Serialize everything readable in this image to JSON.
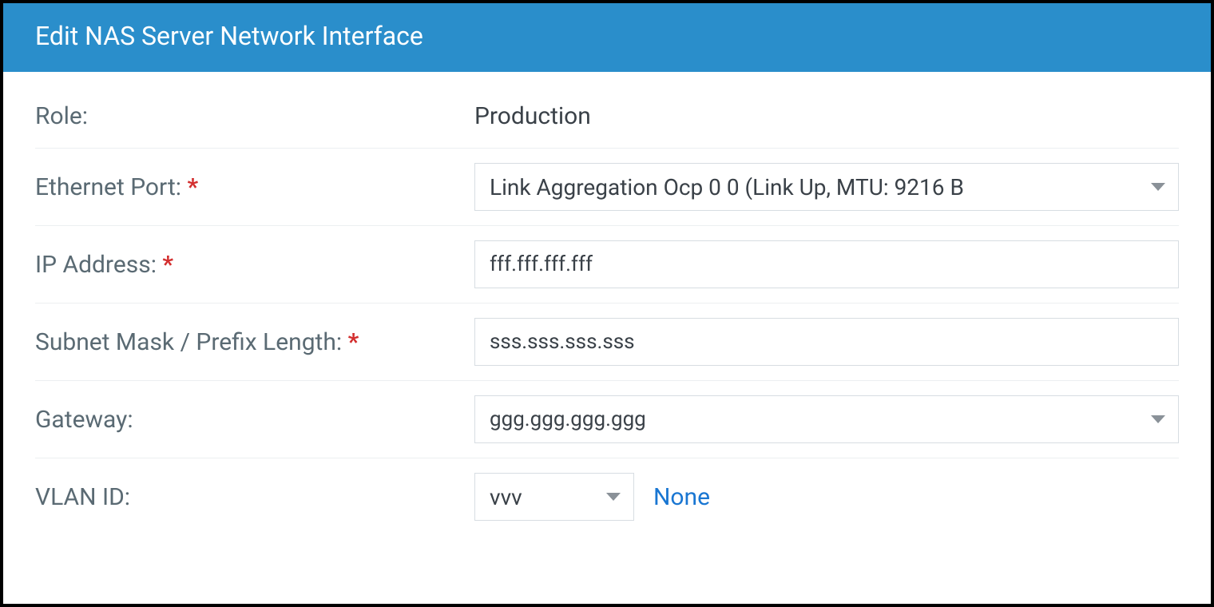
{
  "dialog": {
    "title": "Edit NAS Server Network Interface"
  },
  "fields": {
    "role": {
      "label": "Role:",
      "value": "Production"
    },
    "ethernet_port": {
      "label": "Ethernet Port: ",
      "required_marker": "*",
      "selected": "Link Aggregation Ocp 0 0 (Link Up, MTU: 9216 B"
    },
    "ip_address": {
      "label": "IP Address: ",
      "required_marker": "*",
      "value": "fff.fff.fff.fff"
    },
    "subnet": {
      "label": "Subnet Mask / Prefix Length: ",
      "required_marker": "*",
      "value": "sss.sss.sss.sss"
    },
    "gateway": {
      "label": "Gateway:",
      "value": "ggg.ggg.ggg.ggg"
    },
    "vlan": {
      "label": "VLAN ID:",
      "value": "vvv",
      "none_link": "None"
    }
  }
}
